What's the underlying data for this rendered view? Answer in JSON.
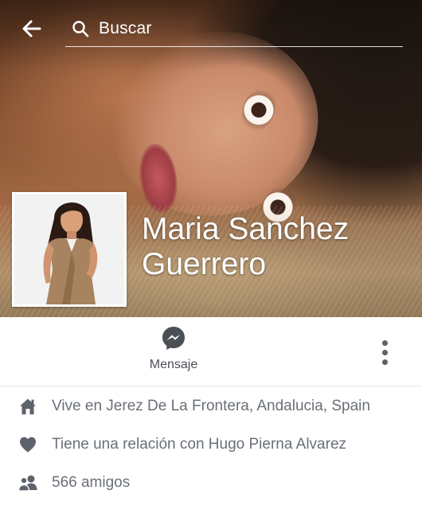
{
  "header": {
    "back_icon": "arrow-left-icon",
    "search_placeholder": "Buscar",
    "search_icon": "search-icon"
  },
  "profile": {
    "name_line1": "Maria Sanchez",
    "name_line2": "Guerrero"
  },
  "actions": {
    "message_label": "Mensaje",
    "message_icon": "messenger-icon",
    "more_icon": "more-vertical-icon"
  },
  "info": [
    {
      "icon": "home-icon",
      "text": "Vive en Jerez De La Frontera, Andalucia, Spain"
    },
    {
      "icon": "heart-icon",
      "text": "Tiene una relación con Hugo Pierna Alvarez"
    },
    {
      "icon": "friends-icon",
      "text": "566 amigos"
    }
  ],
  "colors": {
    "accent": "#4b4f56",
    "secondary_text": "#6a6f78",
    "divider": "#e3e4e8"
  }
}
